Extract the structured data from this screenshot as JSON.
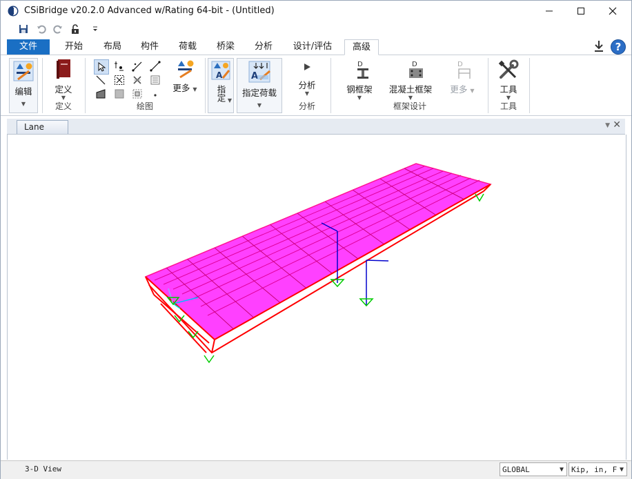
{
  "window": {
    "title": "CSiBridge v20.2.0 Advanced w/Rating 64-bit - (Untitled)"
  },
  "tabs": {
    "file": "文件",
    "items": [
      "开始",
      "布局",
      "构件",
      "荷载",
      "桥梁",
      "分析",
      "设计/评估",
      "高级"
    ],
    "active": "高级"
  },
  "ribbon": {
    "edit": {
      "label": "编辑"
    },
    "define": {
      "button": "定义",
      "group": "定义"
    },
    "draw": {
      "more": "更多",
      "group": "绘图"
    },
    "assign": {
      "label": "指定"
    },
    "assign_loads": {
      "label": "指定荷载"
    },
    "analyze": {
      "button": "分析",
      "group": "分析"
    },
    "frame_design": {
      "steel": "钢框架",
      "concrete": "混凝土框架",
      "more": "更多",
      "group": "框架设计",
      "d_marker": "D"
    },
    "tools": {
      "button": "工具",
      "group": "工具"
    }
  },
  "document": {
    "tab": "Lane"
  },
  "status": {
    "view": "3-D View",
    "coord_system": "GLOBAL",
    "units": "Kip, in, F"
  },
  "colors": {
    "file_tab": "#1a6fc4",
    "deck_fill": "#ff40ff",
    "girders": "#ff0000",
    "axis": "#0000cc",
    "supports": "#00cc00"
  }
}
